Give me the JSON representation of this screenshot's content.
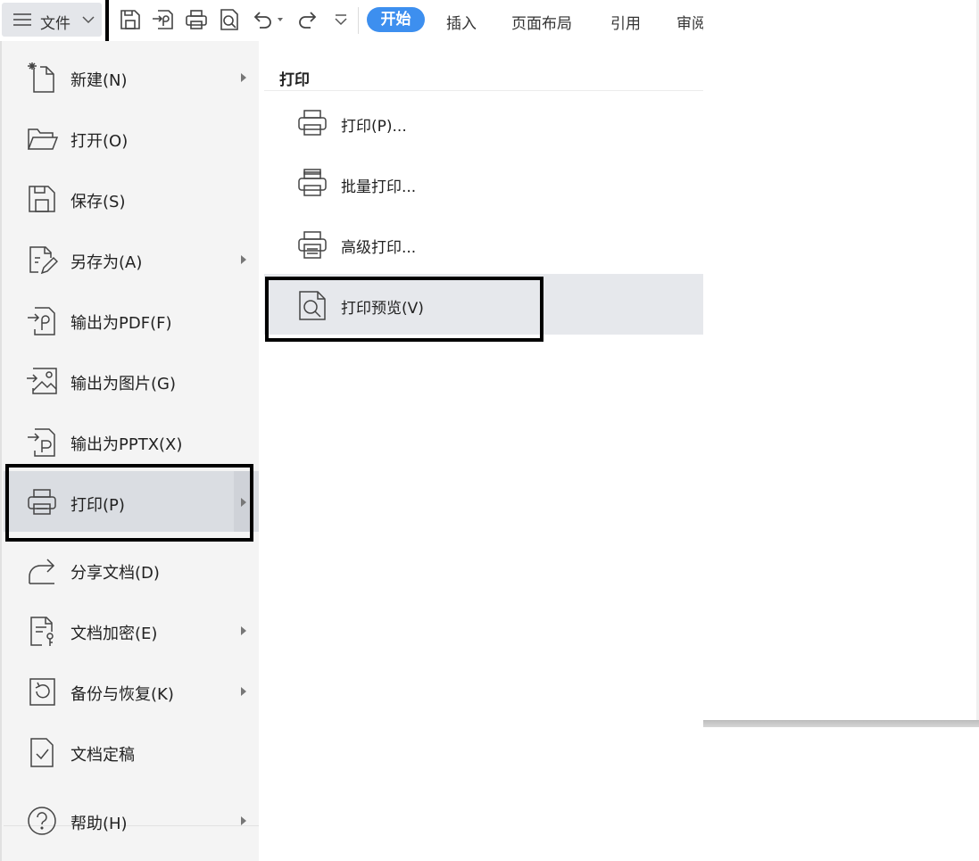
{
  "toolbar": {
    "file_label": "文件",
    "tabs": [
      "开始",
      "插入",
      "页面布局",
      "引用",
      "审阅"
    ],
    "active_tab": "开始",
    "accent_color": "#3d8fef"
  },
  "file_menu": {
    "items": [
      {
        "label": "新建(N)",
        "icon": "new-file-icon",
        "has_submenu": true
      },
      {
        "label": "打开(O)",
        "icon": "folder-open-icon",
        "has_submenu": false
      },
      {
        "label": "保存(S)",
        "icon": "save-icon",
        "has_submenu": false
      },
      {
        "label": "另存为(A)",
        "icon": "save-as-icon",
        "has_submenu": true
      },
      {
        "label": "输出为PDF(F)",
        "icon": "export-pdf-icon",
        "has_submenu": false
      },
      {
        "label": "输出为图片(G)",
        "icon": "export-image-icon",
        "has_submenu": false
      },
      {
        "label": "输出为PPTX(X)",
        "icon": "export-pptx-icon",
        "has_submenu": false
      },
      {
        "label": "打印(P)",
        "icon": "printer-icon",
        "has_submenu": true,
        "selected": true
      },
      {
        "label": "分享文档(D)",
        "icon": "share-icon",
        "has_submenu": false
      },
      {
        "label": "文档加密(E)",
        "icon": "encrypt-doc-icon",
        "has_submenu": true
      },
      {
        "label": "备份与恢复(K)",
        "icon": "backup-restore-icon",
        "has_submenu": true
      },
      {
        "label": "文档定稿",
        "icon": "finalize-doc-icon",
        "has_submenu": false
      },
      {
        "label": "帮助(H)",
        "icon": "help-icon",
        "has_submenu": true
      }
    ]
  },
  "print_submenu": {
    "title": "打印",
    "items": [
      {
        "label": "打印(P)...",
        "icon": "printer-icon"
      },
      {
        "label": "批量打印...",
        "icon": "batch-print-icon"
      },
      {
        "label": "高级打印...",
        "icon": "advanced-print-icon"
      },
      {
        "label": "打印预览(V)",
        "icon": "print-preview-icon",
        "highlighted": true
      }
    ]
  }
}
